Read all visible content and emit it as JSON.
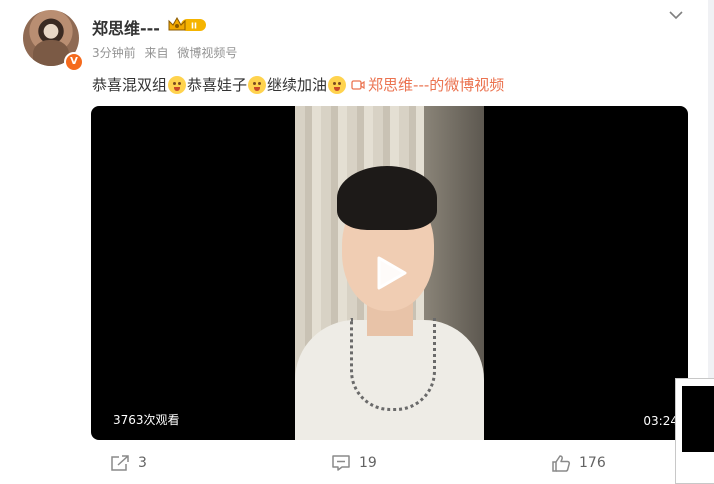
{
  "post": {
    "username": "郑思维---",
    "time": "3分钟前",
    "source_prefix": "来自",
    "source": "微博视频号",
    "text_segments": [
      "恭喜混双组",
      "恭喜娃子",
      "继续加油"
    ],
    "video_link_label": "郑思维---的微博视频"
  },
  "video": {
    "views": "3763次观看",
    "duration": "03:24"
  },
  "actions": {
    "share_count": "3",
    "comment_count": "19",
    "like_count": "176"
  },
  "badges": {
    "verified": "V",
    "vip_level": "II"
  },
  "colors": {
    "accent": "#eb7350",
    "crown": "#f5b400",
    "verified": "#f56a1d"
  },
  "icons": [
    "chevron-down-icon",
    "crown-icon",
    "emoji-icon",
    "video-camera-icon",
    "play-icon",
    "share-icon",
    "comment-icon",
    "like-icon"
  ]
}
